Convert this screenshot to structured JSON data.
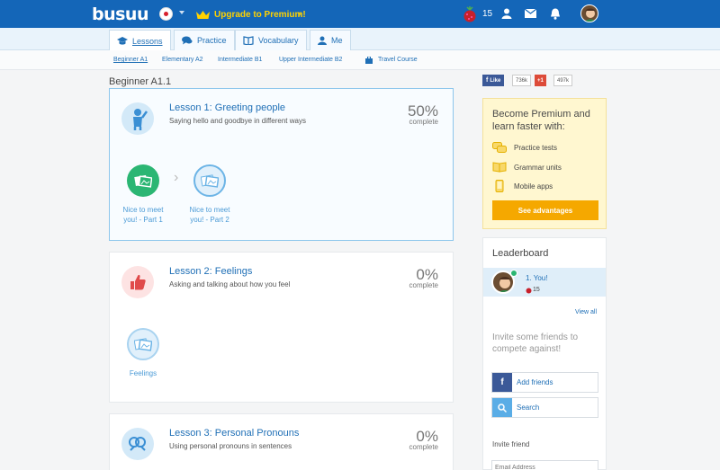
{
  "header": {
    "logo": "busuu",
    "upgrade_label": "Upgrade to Premium!",
    "berries_count": "15"
  },
  "tabs": [
    {
      "label": "Lessons",
      "icon": "graduation-cap-icon"
    },
    {
      "label": "Practice",
      "icon": "chat-bubbles-icon"
    },
    {
      "label": "Vocabulary",
      "icon": "book-icon"
    },
    {
      "label": "Me",
      "icon": "person-icon"
    }
  ],
  "levels": [
    "Beginner A1",
    "Elementary A2",
    "Intermediate B1",
    "Upper Intermediate B2",
    "Travel Course"
  ],
  "section_title": "Beginner A1.1",
  "lessons": [
    {
      "title": "Lesson 1: Greeting people",
      "subtitle": "Saying hello and goodbye in different ways",
      "percent": "50%",
      "complete_label": "complete",
      "units": [
        {
          "label": "Nice to meet you! - Part 1",
          "done": true
        },
        {
          "label": "Nice to meet you! - Part 2",
          "done": false
        }
      ]
    },
    {
      "title": "Lesson 2: Feelings",
      "subtitle": "Asking and talking about how you feel",
      "percent": "0%",
      "complete_label": "complete",
      "units": [
        {
          "label": "Feelings",
          "done": false
        }
      ]
    },
    {
      "title": "Lesson 3: Personal Pronouns",
      "subtitle": "Using personal pronouns in sentences",
      "percent": "0%",
      "complete_label": "complete",
      "units": []
    }
  ],
  "social": {
    "fb_like": "Like",
    "fb_count": "736k",
    "gplus": "+1",
    "gplus_count": "497k"
  },
  "premium": {
    "title": "Become Premium and learn faster with:",
    "perks": [
      "Practice tests",
      "Grammar units",
      "Mobile apps"
    ],
    "button": "See advantages"
  },
  "leaderboard": {
    "title": "Leaderboard",
    "entry_name": "1. You!",
    "entry_score": "15",
    "view_all": "View all",
    "invite_text": "Invite some friends to compete against!",
    "add_friends": "Add friends",
    "search": "Search",
    "invite_friend": "Invite friend",
    "email_placeholder": "Email Address"
  },
  "colors": {
    "brand_blue": "#1466b8",
    "accent_orange": "#f5a800",
    "success_green": "#2bb673"
  }
}
